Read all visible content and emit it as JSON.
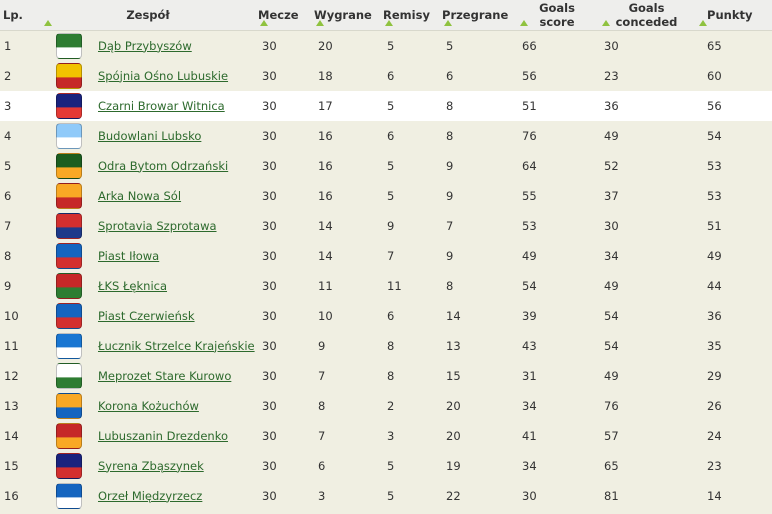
{
  "headers": {
    "lp": "Lp.",
    "team": "Zespół",
    "matches": "Mecze",
    "wins": "Wygrane",
    "draws": "Remisy",
    "losses": "Przegrane",
    "goals_scored_1": "Goals",
    "goals_scored_2": "score",
    "goals_conceded_1": "Goals",
    "goals_conceded_2": "conceded",
    "points": "Punkty"
  },
  "colors": {
    "accent": "#8fc23f",
    "link": "#2d6a2d",
    "background": "#f0efe2",
    "highlight_row": "#ffffff"
  },
  "rows": [
    {
      "lp": "1",
      "team": "Dąb Przybyszów",
      "matches": "30",
      "wins": "20",
      "draws": "5",
      "losses": "5",
      "gs": "66",
      "gc": "30",
      "pts": "65",
      "crest": "#2e7d32",
      "crest2": "#ffffff",
      "icon": "dab-crest-icon"
    },
    {
      "lp": "2",
      "team": "Spójnia Ośno Lubuskie",
      "matches": "30",
      "wins": "18",
      "draws": "6",
      "losses": "6",
      "gs": "56",
      "gc": "23",
      "pts": "60",
      "crest": "#f2c200",
      "crest2": "#c62828",
      "icon": "spojnia-crest-icon"
    },
    {
      "lp": "3",
      "team": "Czarni Browar Witnica",
      "matches": "30",
      "wins": "17",
      "draws": "5",
      "losses": "8",
      "gs": "51",
      "gc": "36",
      "pts": "56",
      "crest": "#1a237e",
      "crest2": "#e53935",
      "icon": "czarni-crest-icon"
    },
    {
      "lp": "4",
      "team": "Budowlani Lubsko",
      "matches": "30",
      "wins": "16",
      "draws": "6",
      "losses": "8",
      "gs": "76",
      "gc": "49",
      "pts": "54",
      "crest": "#90caf9",
      "crest2": "#ffffff",
      "icon": "budowlani-crest-icon"
    },
    {
      "lp": "5",
      "team": "Odra Bytom Odrzański",
      "matches": "30",
      "wins": "16",
      "draws": "5",
      "losses": "9",
      "gs": "64",
      "gc": "52",
      "pts": "53",
      "crest": "#1b5e20",
      "crest2": "#f9a825",
      "icon": "odra-crest-icon"
    },
    {
      "lp": "6",
      "team": "Arka Nowa Sól",
      "matches": "30",
      "wins": "16",
      "draws": "5",
      "losses": "9",
      "gs": "55",
      "gc": "37",
      "pts": "53",
      "crest": "#f9a825",
      "crest2": "#c62828",
      "icon": "arka-crest-icon"
    },
    {
      "lp": "7",
      "team": "Sprotavia Szprotawa",
      "matches": "30",
      "wins": "14",
      "draws": "9",
      "losses": "7",
      "gs": "53",
      "gc": "30",
      "pts": "51",
      "crest": "#d32f2f",
      "crest2": "#1e3a8a",
      "icon": "sprotavia-crest-icon"
    },
    {
      "lp": "8",
      "team": "Piast Iłowa",
      "matches": "30",
      "wins": "14",
      "draws": "7",
      "losses": "9",
      "gs": "49",
      "gc": "34",
      "pts": "49",
      "crest": "#1565c0",
      "crest2": "#d32f2f",
      "icon": "piast-ilowa-crest-icon"
    },
    {
      "lp": "9",
      "team": "ŁKS Łęknica",
      "matches": "30",
      "wins": "11",
      "draws": "11",
      "losses": "8",
      "gs": "54",
      "gc": "49",
      "pts": "44",
      "crest": "#c62828",
      "crest2": "#2e7d32",
      "icon": "lks-crest-icon"
    },
    {
      "lp": "10",
      "team": "Piast Czerwieńsk",
      "matches": "30",
      "wins": "10",
      "draws": "6",
      "losses": "14",
      "gs": "39",
      "gc": "54",
      "pts": "36",
      "crest": "#1565c0",
      "crest2": "#d32f2f",
      "icon": "piast-czerwiensk-crest-icon"
    },
    {
      "lp": "11",
      "team": "Łucznik Strzelce Krajeńskie",
      "matches": "30",
      "wins": "9",
      "draws": "8",
      "losses": "13",
      "gs": "43",
      "gc": "54",
      "pts": "35",
      "crest": "#1976d2",
      "crest2": "#ffffff",
      "icon": "lucznik-crest-icon"
    },
    {
      "lp": "12",
      "team": "Meprozet Stare Kurowo",
      "matches": "30",
      "wins": "7",
      "draws": "8",
      "losses": "15",
      "gs": "31",
      "gc": "49",
      "pts": "29",
      "crest": "#ffffff",
      "crest2": "#2e7d32",
      "icon": "meprozet-crest-icon"
    },
    {
      "lp": "13",
      "team": "Korona Kożuchów",
      "matches": "30",
      "wins": "8",
      "draws": "2",
      "losses": "20",
      "gs": "34",
      "gc": "76",
      "pts": "26",
      "crest": "#f9a825",
      "crest2": "#1565c0",
      "icon": "korona-crest-icon"
    },
    {
      "lp": "14",
      "team": "Lubuszanin Drezdenko",
      "matches": "30",
      "wins": "7",
      "draws": "3",
      "losses": "20",
      "gs": "41",
      "gc": "57",
      "pts": "24",
      "crest": "#c62828",
      "crest2": "#f9a825",
      "icon": "lubuszanin-crest-icon"
    },
    {
      "lp": "15",
      "team": "Syrena Zbąszynek",
      "matches": "30",
      "wins": "6",
      "draws": "5",
      "losses": "19",
      "gs": "34",
      "gc": "65",
      "pts": "23",
      "crest": "#1a237e",
      "crest2": "#d32f2f",
      "icon": "syrena-crest-icon"
    },
    {
      "lp": "16",
      "team": "Orzeł Międzyrzecz",
      "matches": "30",
      "wins": "3",
      "draws": "5",
      "losses": "22",
      "gs": "30",
      "gc": "81",
      "pts": "14",
      "crest": "#1565c0",
      "crest2": "#ffffff",
      "icon": "orzel-crest-icon"
    }
  ]
}
